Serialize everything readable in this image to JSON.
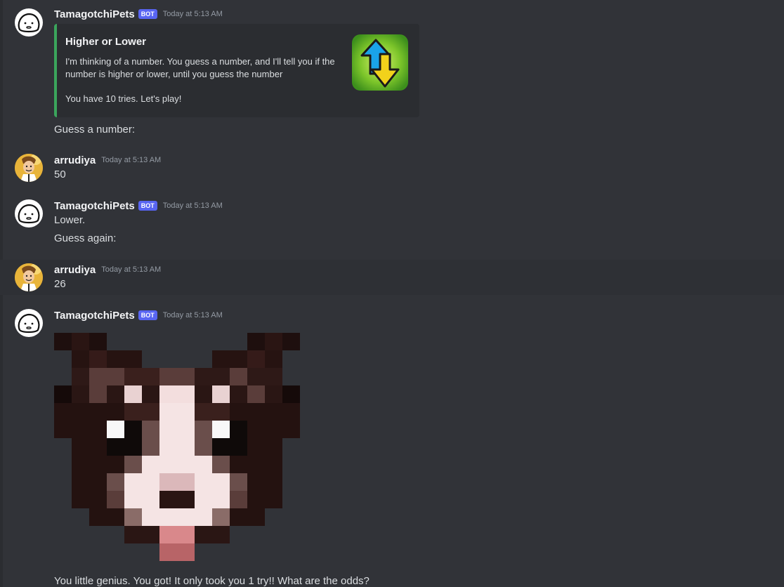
{
  "bot": {
    "name": "TamagotchiPets",
    "badge": "BOT",
    "avatar": "blob-face-avatar"
  },
  "user": {
    "name": "arrudiya",
    "avatar": "cartoon-man-avatar"
  },
  "timestamp": "Today at 5:13 AM",
  "colors": {
    "background": "#313338",
    "embed_accent": "#3ba55c",
    "badge": "#5865f2"
  },
  "messages": [
    {
      "author": "TamagotchiPets",
      "embed": {
        "title": "Higher or Lower",
        "description": "I'm thinking of a number. You guess a number, and I'll tell you if the number is higher or lower, until you guess the number",
        "footer_text": "You have 10 tries. Let's play!",
        "thumbnail_icon": "up-down-arrows-icon"
      },
      "text": "Guess a number:"
    },
    {
      "author": "arrudiya",
      "text": "50"
    },
    {
      "author": "TamagotchiPets",
      "text": "Lower.",
      "text2": "Guess again:"
    },
    {
      "author": "arrudiya",
      "text": "26"
    },
    {
      "author": "TamagotchiPets",
      "image": "pixel-art-pet-face",
      "text": "You little genius. You got! It only took you 1 try!! What are the odds?"
    }
  ]
}
